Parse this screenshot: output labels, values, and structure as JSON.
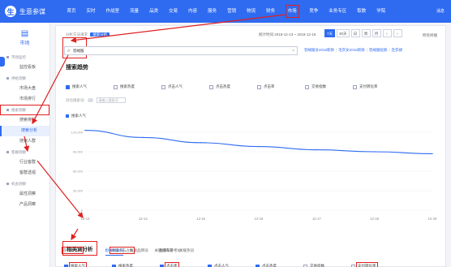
{
  "header": {
    "logo_glyph": "生",
    "brand": "生意参谋",
    "nav": [
      "首页",
      "实时",
      "作战室",
      "流量",
      "品类",
      "交易",
      "内容",
      "服务",
      "营销",
      "物流",
      "财务",
      "市场",
      "竞争",
      "业务专区",
      "取数",
      "学院"
    ],
    "active_nav": "市场",
    "user": "消息"
  },
  "sidebar": {
    "head_label": "市场",
    "items": [
      {
        "label": "市场监控",
        "group": true
      },
      {
        "label": "监控看板"
      },
      {
        "label": "供给洞察",
        "group": true
      },
      {
        "label": "市场大盘"
      },
      {
        "label": "市场排行"
      },
      {
        "label": "搜索洞察",
        "group": true,
        "boxed": true
      },
      {
        "label": "搜索排行"
      },
      {
        "label": "搜索分析",
        "active": true
      },
      {
        "label": "搜索人群"
      },
      {
        "label": "客群洞察",
        "group": true
      },
      {
        "label": "行业客群"
      },
      {
        "label": "客群透视"
      },
      {
        "label": "机会洞察",
        "group": true
      },
      {
        "label": "属性洞察"
      },
      {
        "label": "产品洞察"
      }
    ]
  },
  "toolbar": {
    "crumb": "分析方法请求",
    "crumb_tag": "搜索分析",
    "date_range": "统计时间 2018-12-13 ~ 2018-12-19",
    "ranges": [
      "7天",
      "30天",
      "日",
      "周",
      "月"
    ],
    "active_range": "7天",
    "extra": "所有终端"
  },
  "search": {
    "value": "羽绒服",
    "clear": "×",
    "quick_links": [
      "羽绒服女2018新款",
      "毛衣女2018新款",
      "羽绒服短款",
      "连衣裙"
    ]
  },
  "trend": {
    "title": "搜索趋势",
    "metrics": [
      {
        "label": "搜索人气",
        "on": true
      },
      {
        "label": "搜索热度",
        "on": false
      },
      {
        "label": "点击人气",
        "on": false
      },
      {
        "label": "点击热度",
        "on": false
      },
      {
        "label": "点击率",
        "on": false
      },
      {
        "label": "交易指数",
        "on": false
      },
      {
        "label": "支付转化率",
        "on": false
      }
    ],
    "compare_label": "对比搜索词",
    "compare_placeholder": "请输入搜索词"
  },
  "chart_data": {
    "type": "line",
    "x": [
      "12-13",
      "12-14",
      "12-15",
      "12-16",
      "12-17",
      "12-18",
      "12-19"
    ],
    "series": [
      {
        "name": "搜索人气",
        "values": [
          123000,
          112000,
          104000,
          98000,
          93000,
          90000,
          87000
        ]
      }
    ],
    "y_ticks": [
      "120,000",
      "90,000",
      "60,000",
      "30,000",
      "0"
    ],
    "ylim": [
      0,
      130000
    ],
    "grid": true,
    "legend": "top-left",
    "color": "#2f6bf1"
  },
  "related": {
    "title": "相关词分析",
    "tabs": [
      "相关搜索词",
      "关联品牌词",
      "关联修饰词",
      "关联热词"
    ],
    "active_tab": "相关搜索词",
    "metrics": [
      {
        "label": "搜索人气",
        "on": true,
        "hl": true
      },
      {
        "label": "搜索热度",
        "on": true,
        "hl": false
      },
      {
        "label": "点击率",
        "on": true,
        "hl": true
      },
      {
        "label": "点击人气",
        "on": true,
        "hl": false
      },
      {
        "label": "点击热度",
        "on": true,
        "hl": false
      },
      {
        "label": "交易指数",
        "on": false,
        "hl": false
      },
      {
        "label": "支付转化率",
        "on": false,
        "hl": true
      }
    ],
    "sub": [
      {
        "label": "在线商品数",
        "hl": true
      },
      {
        "label": "商城点击占比",
        "hl": true
      },
      {
        "label": "直通车参考价",
        "hl": false
      }
    ]
  }
}
